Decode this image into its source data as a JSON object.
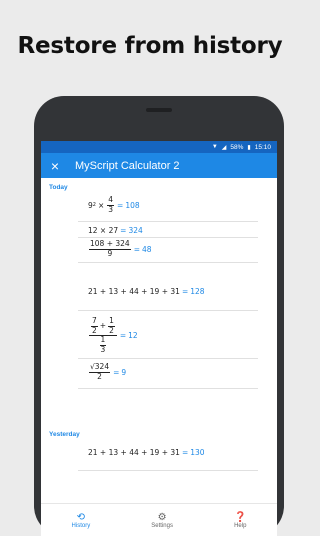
{
  "headline": "Restore from history",
  "status": {
    "battery": "58%",
    "time": "15:10"
  },
  "appbar": {
    "title": "MyScript Calculator 2",
    "close_icon": "×"
  },
  "sections": {
    "today": "Today",
    "yesterday": "Yesterday"
  },
  "entries": {
    "e1": {
      "a": "9",
      "exp": "2",
      "op": "×",
      "num": "4",
      "den": "3",
      "eq": "=",
      "result": "108"
    },
    "e2": {
      "expr": "12 × 27",
      "eq": "=",
      "result": "324"
    },
    "e3": {
      "num": "108 + 324",
      "den": "9",
      "eq": "=",
      "result": "48"
    },
    "e4": {
      "expr": "21 + 13 + 44 + 19 + 31",
      "eq": "=",
      "result": "128"
    },
    "e5": {
      "n1": "7",
      "d1": "2",
      "plus": "+",
      "n2": "1",
      "d2": "2",
      "den": "1",
      "dd": "3",
      "eq": "=",
      "result": "12"
    },
    "e6": {
      "root": "√324",
      "den": "2",
      "eq": "=",
      "result": "9"
    },
    "e7": {
      "expr": "21 + 13 + 44 + 19 + 31",
      "eq": "=",
      "result": "130"
    }
  },
  "nav": {
    "history": "History",
    "settings": "Settings",
    "help": "Help"
  },
  "colors": {
    "accent": "#1e88e5",
    "statusbar": "#1565c0"
  }
}
